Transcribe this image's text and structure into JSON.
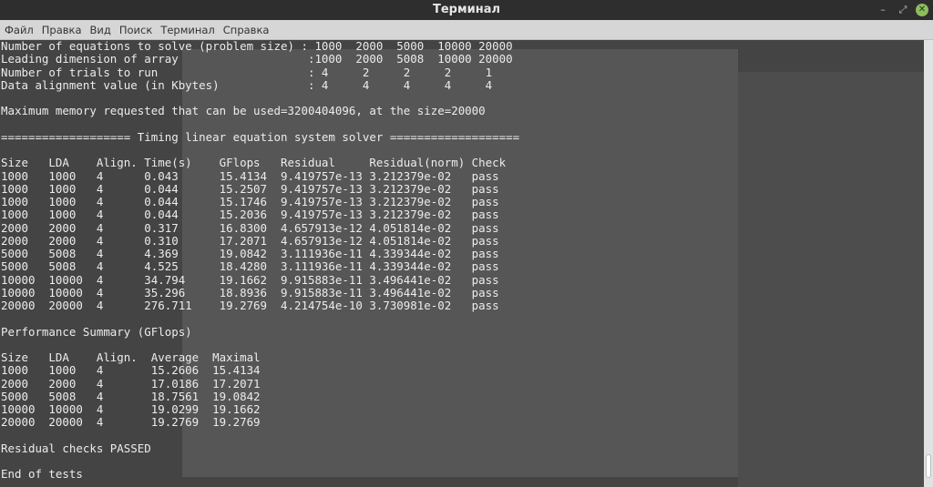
{
  "window": {
    "title": "Терминал"
  },
  "menu": [
    "Файл",
    "Правка",
    "Вид",
    "Поиск",
    "Терминал",
    "Справка"
  ],
  "terminal": {
    "lines": [
      "Number of equations to solve (problem size) : 1000  2000  5000  10000 20000",
      "Leading dimension of array                   :1000  2000  5008  10000 20000",
      "Number of trials to run                      : 4     2     2     2     1",
      "Data alignment value (in Kbytes)             : 4     4     4     4     4",
      "",
      "Maximum memory requested that can be used=3200404096, at the size=20000",
      "",
      "=================== Timing linear equation system solver ===================",
      "",
      "Size   LDA    Align. Time(s)    GFlops   Residual     Residual(norm) Check",
      "1000   1000   4      0.043      15.4134  9.419757e-13 3.212379e-02   pass",
      "1000   1000   4      0.044      15.2507  9.419757e-13 3.212379e-02   pass",
      "1000   1000   4      0.044      15.1746  9.419757e-13 3.212379e-02   pass",
      "1000   1000   4      0.044      15.2036  9.419757e-13 3.212379e-02   pass",
      "2000   2000   4      0.317      16.8300  4.657913e-12 4.051814e-02   pass",
      "2000   2000   4      0.310      17.2071  4.657913e-12 4.051814e-02   pass",
      "5000   5008   4      4.369      19.0842  3.111936e-11 4.339344e-02   pass",
      "5000   5008   4      4.525      18.4280  3.111936e-11 4.339344e-02   pass",
      "10000  10000  4      34.794     19.1662  9.915883e-11 3.496441e-02   pass",
      "10000  10000  4      35.296     18.8936  9.915883e-11 3.496441e-02   pass",
      "20000  20000  4      276.711    19.2769  4.214754e-10 3.730981e-02   pass",
      "",
      "Performance Summary (GFlops)",
      "",
      "Size   LDA    Align.  Average  Maximal",
      "1000   1000   4       15.2606  15.4134",
      "2000   2000   4       17.0186  17.2071",
      "5000   5008   4       18.7561  19.0842",
      "10000  10000  4       19.0299  19.1662",
      "20000  20000  4       19.2769  19.2769",
      "",
      "Residual checks PASSED",
      "",
      "End of tests"
    ]
  }
}
